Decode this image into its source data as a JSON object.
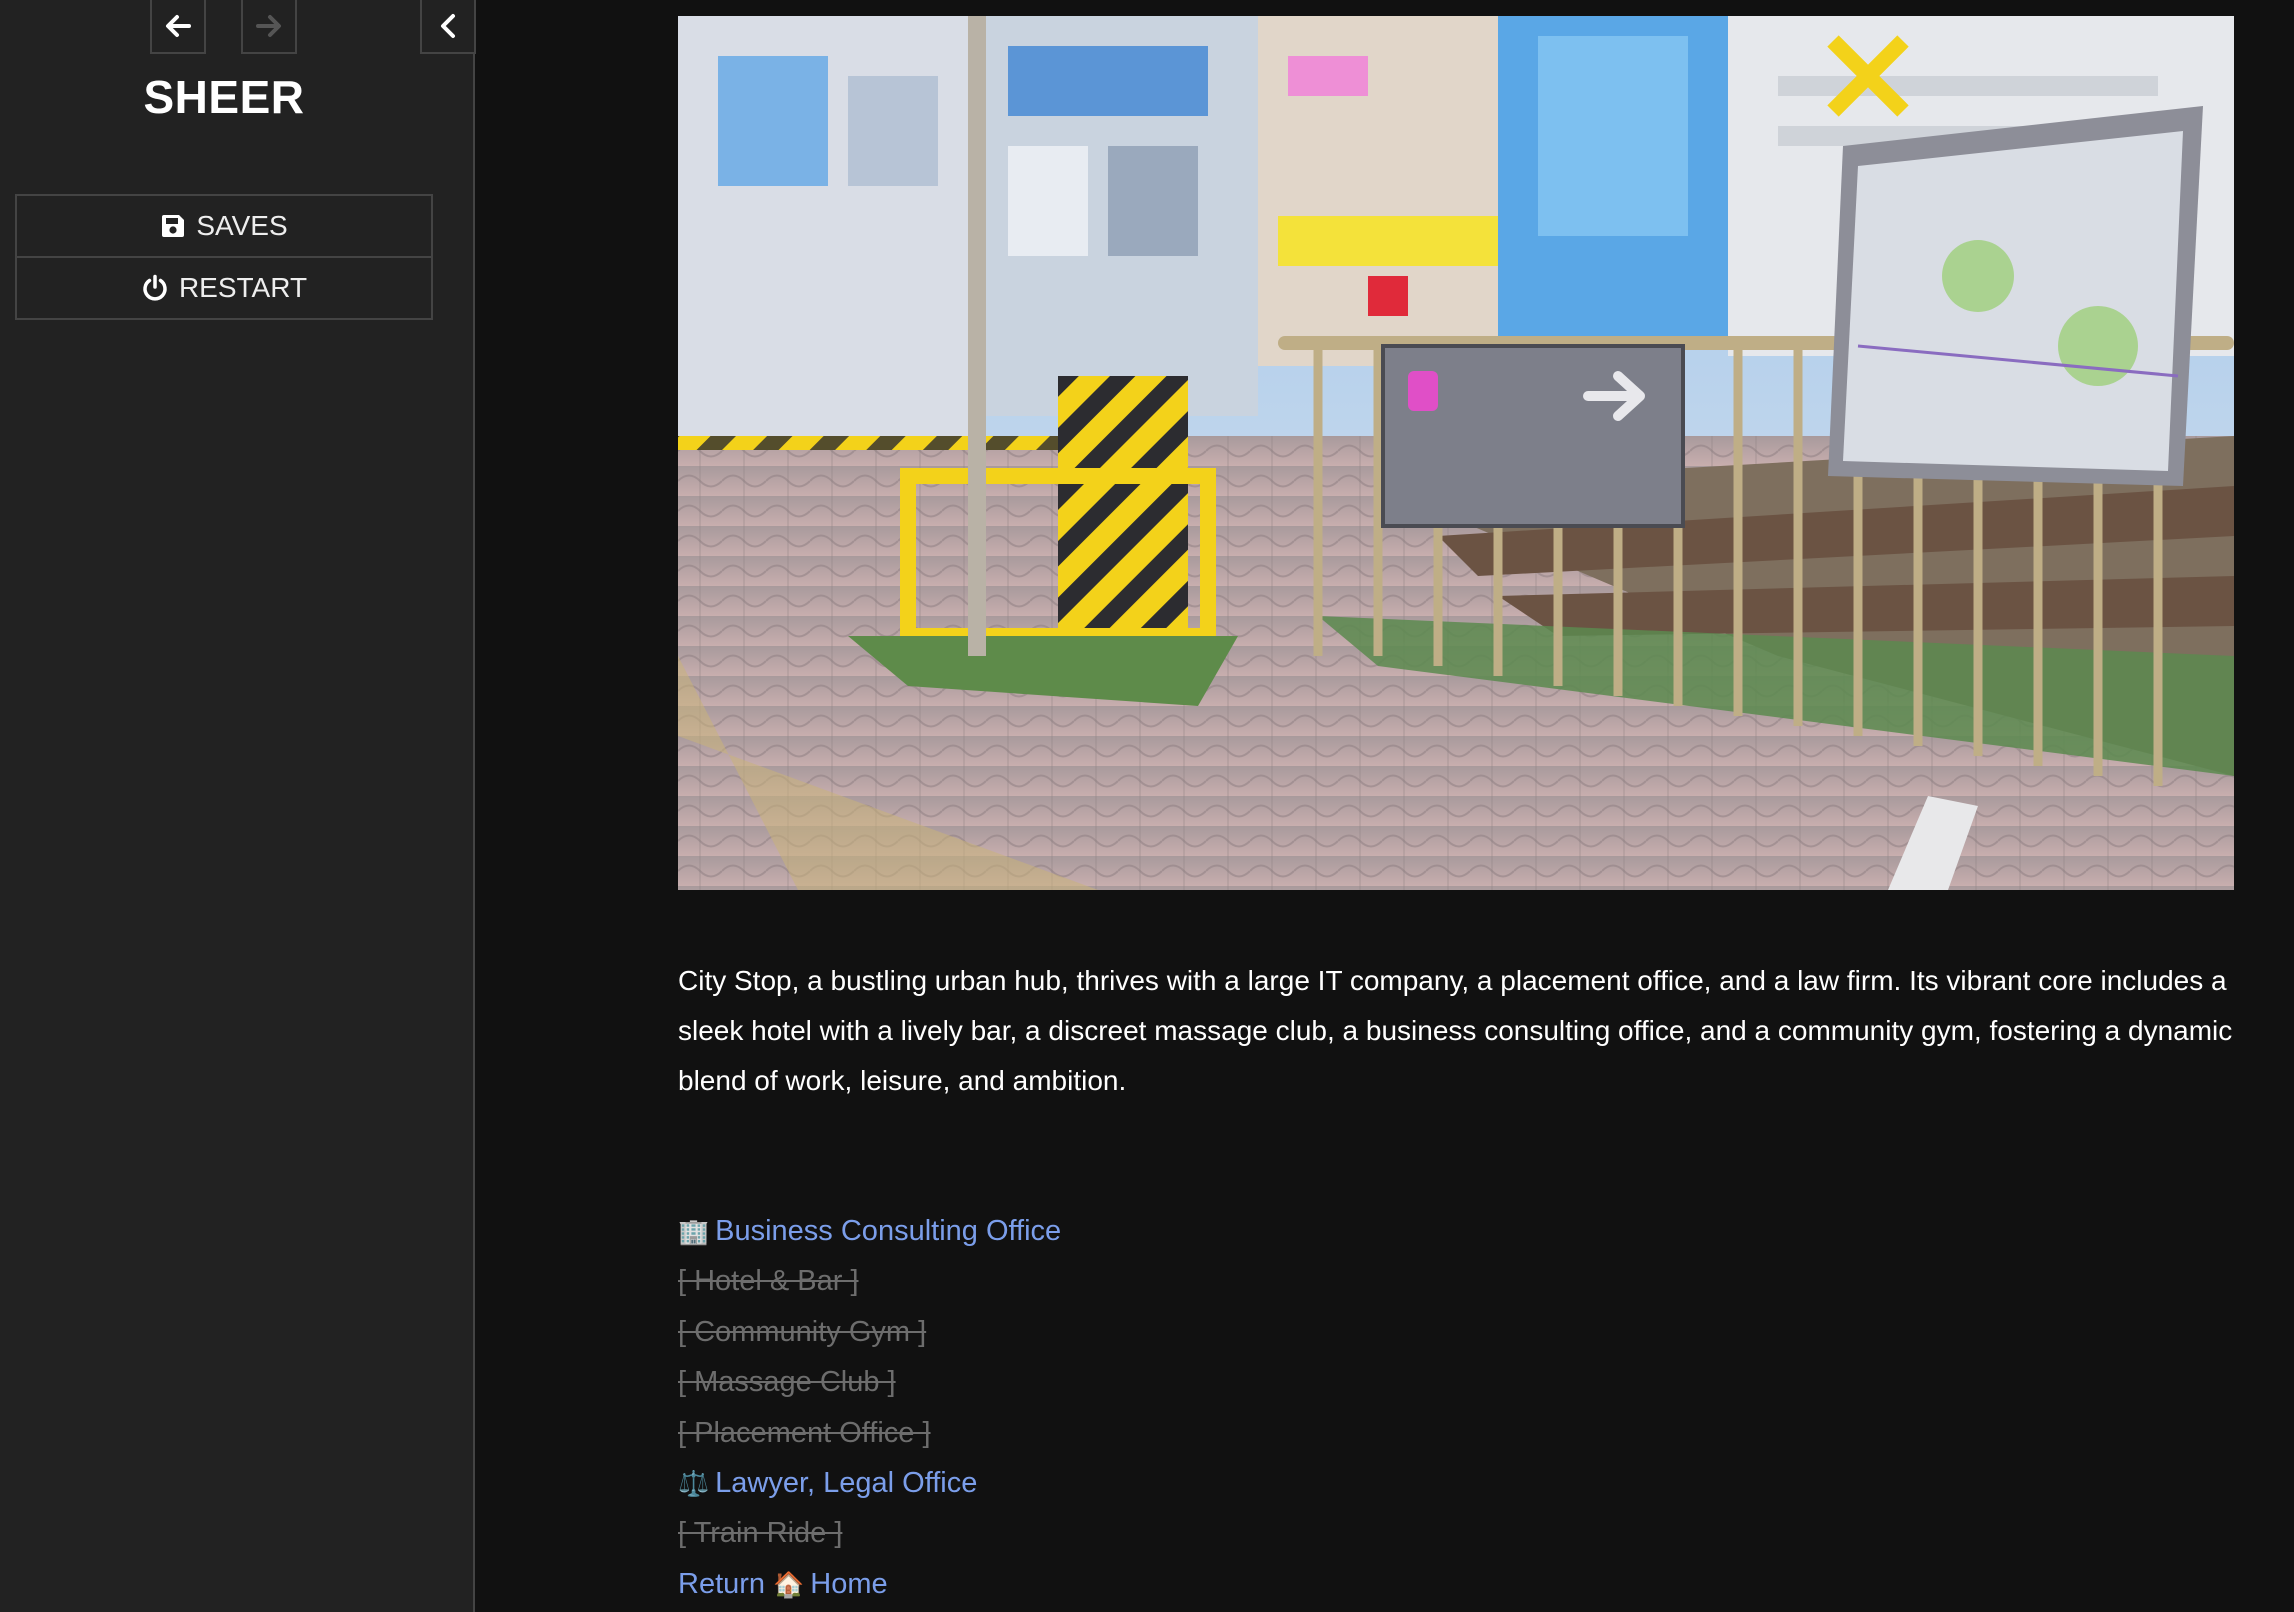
{
  "sidebar": {
    "title": "SHEER",
    "menu": [
      {
        "label": "SAVES",
        "icon": "save-icon"
      },
      {
        "label": "RESTART",
        "icon": "power-icon"
      }
    ],
    "history": {
      "back_icon": "arrow-left-icon",
      "forward_icon": "arrow-right-icon",
      "toggle_icon": "chevron-left-icon"
    }
  },
  "passage": {
    "description": "City Stop, a bustling urban hub, thrives with a large IT company, a placement office, and a law firm. Its vibrant core includes a sleek hotel with a lively bar, a discreet massage club, a business consulting office, and a community gym, fostering a dynamic blend of work, leisure, and ambition.",
    "links": {
      "business_icon": "🏢",
      "business_label": "Business Consulting Office",
      "hotel": "[ Hotel & Bar ]",
      "gym": "[ Community Gym ]",
      "massage": "[ Massage Club ]",
      "placement": "[ Placement Office ]",
      "lawyer_icon": "⚖️",
      "lawyer_label": "Lawyer, Legal Office",
      "train": "[ Train Ride ]",
      "return_label": "Return",
      "home_icon": "🏠",
      "home_label": "Home"
    }
  },
  "colors": {
    "background": "#111111",
    "sidebar": "#222222",
    "link": "#7b9eea",
    "disabled": "#6d6d6d"
  }
}
